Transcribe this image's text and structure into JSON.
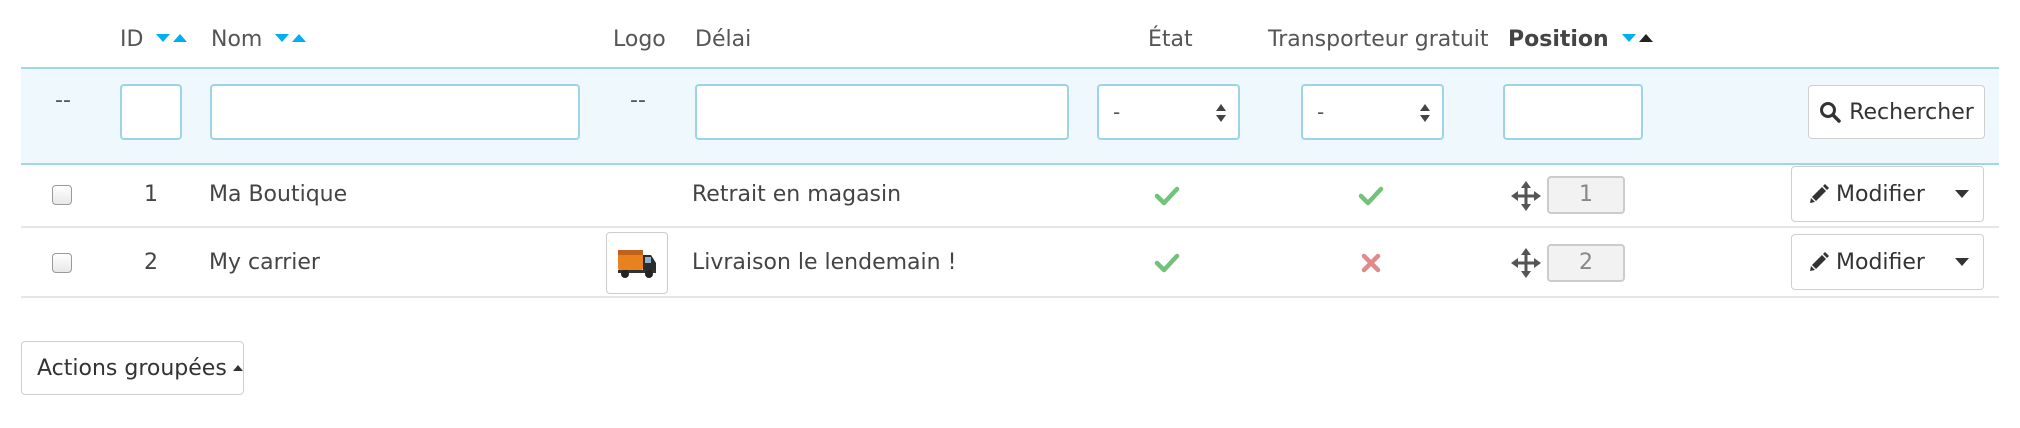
{
  "headers": {
    "id": "ID",
    "nom": "Nom",
    "logo": "Logo",
    "delai": "Délai",
    "etat": "État",
    "transporteur": "Transporteur gratuit",
    "position": "Position"
  },
  "filters": {
    "checkbox_placeholder": "--",
    "logo_placeholder": "--",
    "etat_value": "-",
    "transporteur_value": "-",
    "search_label": "Rechercher"
  },
  "rows": [
    {
      "id": "1",
      "nom": "Ma Boutique",
      "logo": "",
      "delai": "Retrait en magasin",
      "etat": "check-icon",
      "transporteur": "check-icon",
      "position": "1",
      "action_label": "Modifier"
    },
    {
      "id": "2",
      "nom": "My carrier",
      "logo": "truck-icon",
      "delai": "Livraison le lendemain !",
      "etat": "check-icon",
      "transporteur": "cross-icon",
      "position": "2",
      "action_label": "Modifier"
    }
  ],
  "bulk_actions": {
    "label": "Actions groupées"
  },
  "colors": {
    "sort_arrow": "#00aff0",
    "filter_border": "#9fd3e8",
    "filter_bg": "#eff8fc",
    "check": "#72c279",
    "cross": "#e08b8b"
  }
}
